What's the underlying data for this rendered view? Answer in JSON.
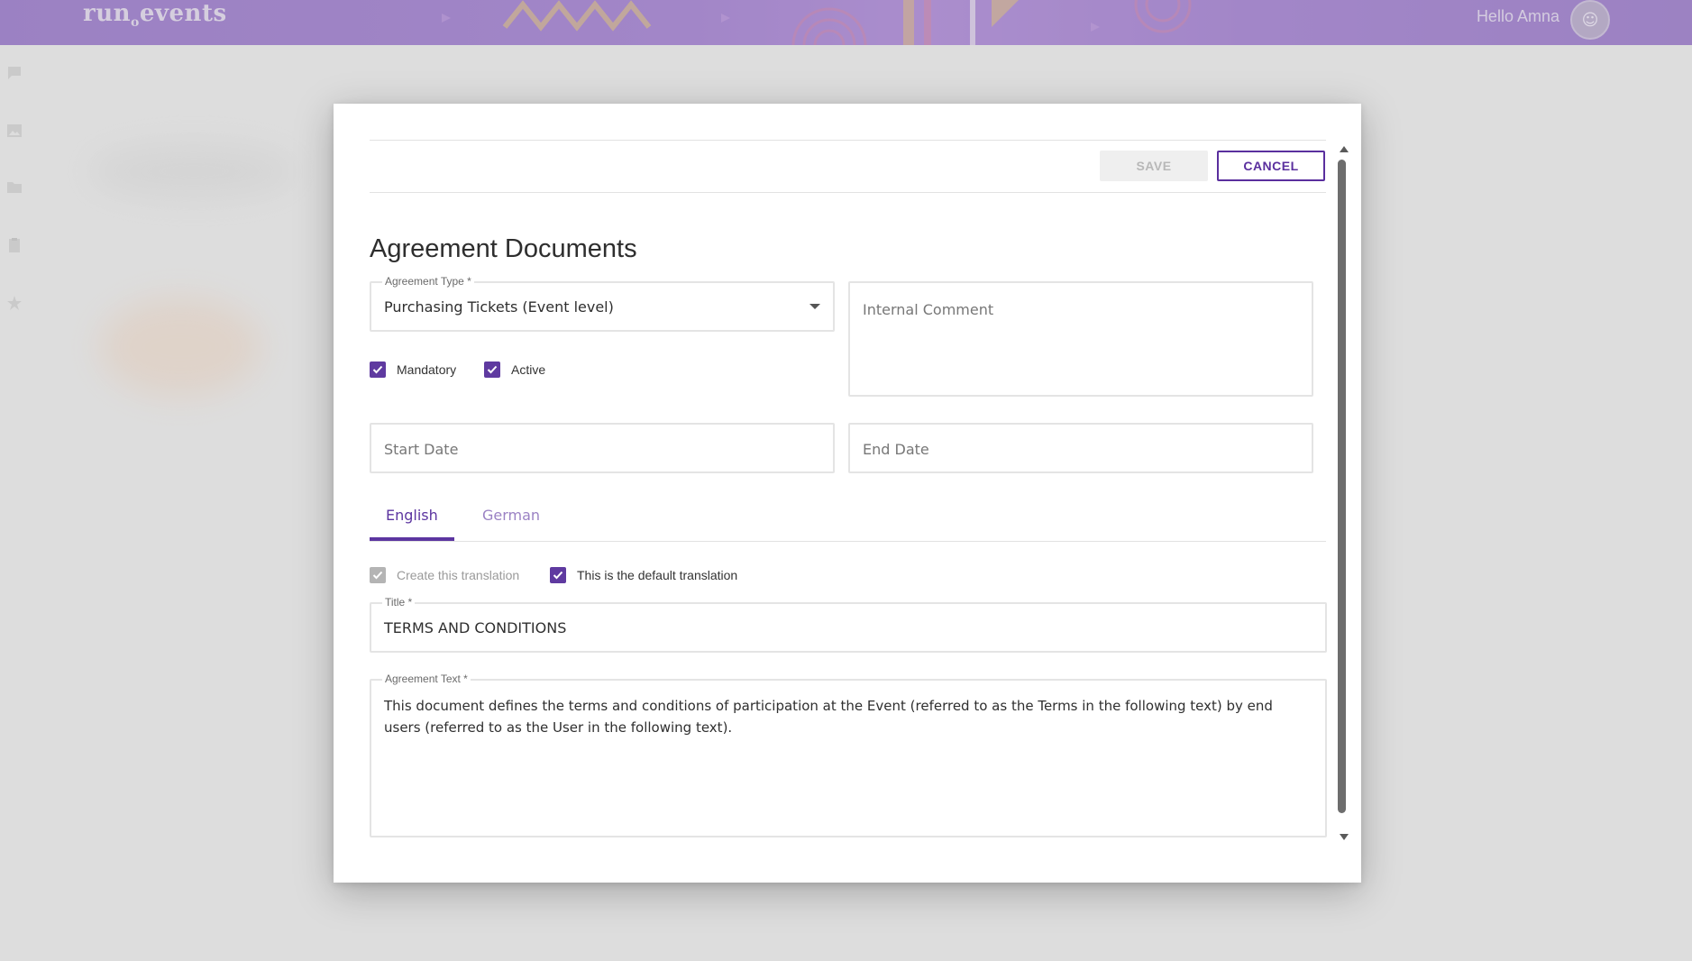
{
  "app": {
    "brand": "run",
    "brand_dot": "o",
    "brand_suffix": "events",
    "greeting": "Hello Amna"
  },
  "sidebar": {
    "icons": [
      "chat-icon",
      "image-icon",
      "folder-icon",
      "clipboard-icon",
      "star-icon"
    ]
  },
  "toolbar": {
    "save_label": "SAVE",
    "cancel_label": "CANCEL"
  },
  "form": {
    "heading": "Agreement Documents",
    "agreement_type": {
      "label": "Agreement Type *",
      "value": "Purchasing Tickets (Event level)"
    },
    "internal_comment": {
      "placeholder": "Internal Comment"
    },
    "mandatory": {
      "label": "Mandatory",
      "checked": true
    },
    "active": {
      "label": "Active",
      "checked": true
    },
    "start_date": {
      "placeholder": "Start Date"
    },
    "end_date": {
      "placeholder": "End Date"
    },
    "tabs": [
      {
        "label": "English",
        "active": true
      },
      {
        "label": "German",
        "active": false
      }
    ],
    "create_translation": {
      "label": "Create this translation",
      "checked": true,
      "disabled": true
    },
    "default_translation": {
      "label": "This is the default translation",
      "checked": true
    },
    "title": {
      "label": "Title *",
      "value": "TERMS AND CONDITIONS"
    },
    "agreement_text": {
      "label": "Agreement Text *",
      "value": "This document defines the terms and conditions of participation at the Event (referred to as the Terms in the following text) by end users (referred to as the User in the following text)."
    }
  },
  "colors": {
    "accent": "#5c35a0",
    "topbar": "#7a47bf"
  }
}
